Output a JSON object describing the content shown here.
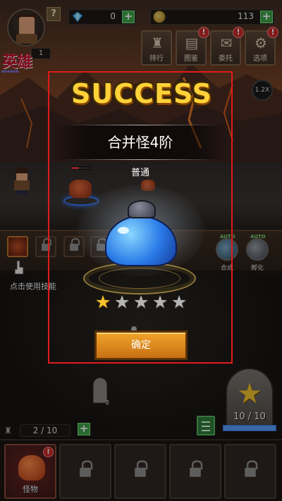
{
  "hud": {
    "help": "?",
    "hero_label": "英雄",
    "hero_level": "1",
    "gems": "0",
    "gold": "113",
    "plus": "+",
    "menu": [
      {
        "label": "排行",
        "icon": "trophy-icon",
        "alert": false
      },
      {
        "label": "图鉴",
        "icon": "book-icon",
        "alert": true
      },
      {
        "label": "委托",
        "icon": "scroll-icon",
        "alert": true
      },
      {
        "label": "选项",
        "icon": "gear-icon",
        "alert": true
      }
    ],
    "speed": "1.2X"
  },
  "battle": {
    "tap_hint": "点击使用技能",
    "auto_tag": "AUTO",
    "auto_buttons": [
      "合成",
      "孵化"
    ]
  },
  "bottom": {
    "capacity": "2 / 10",
    "tomb_count": "10 / 10",
    "tomb_fill": 1.0,
    "tray_first_label": "怪物",
    "tray_alert": "!"
  },
  "dialog": {
    "title": "SUCCESS",
    "merge_text": "合并怪4阶",
    "rarity": "普通",
    "stars_total": 5,
    "stars_filled": 1,
    "confirm_label": "确定"
  },
  "colors": {
    "success_gold": "#ffd23a",
    "star_on": "#f6c22e",
    "star_off": "#b5b5b5",
    "confirm_orange": "#e08a1e",
    "frame_red": "#e01b1b"
  }
}
